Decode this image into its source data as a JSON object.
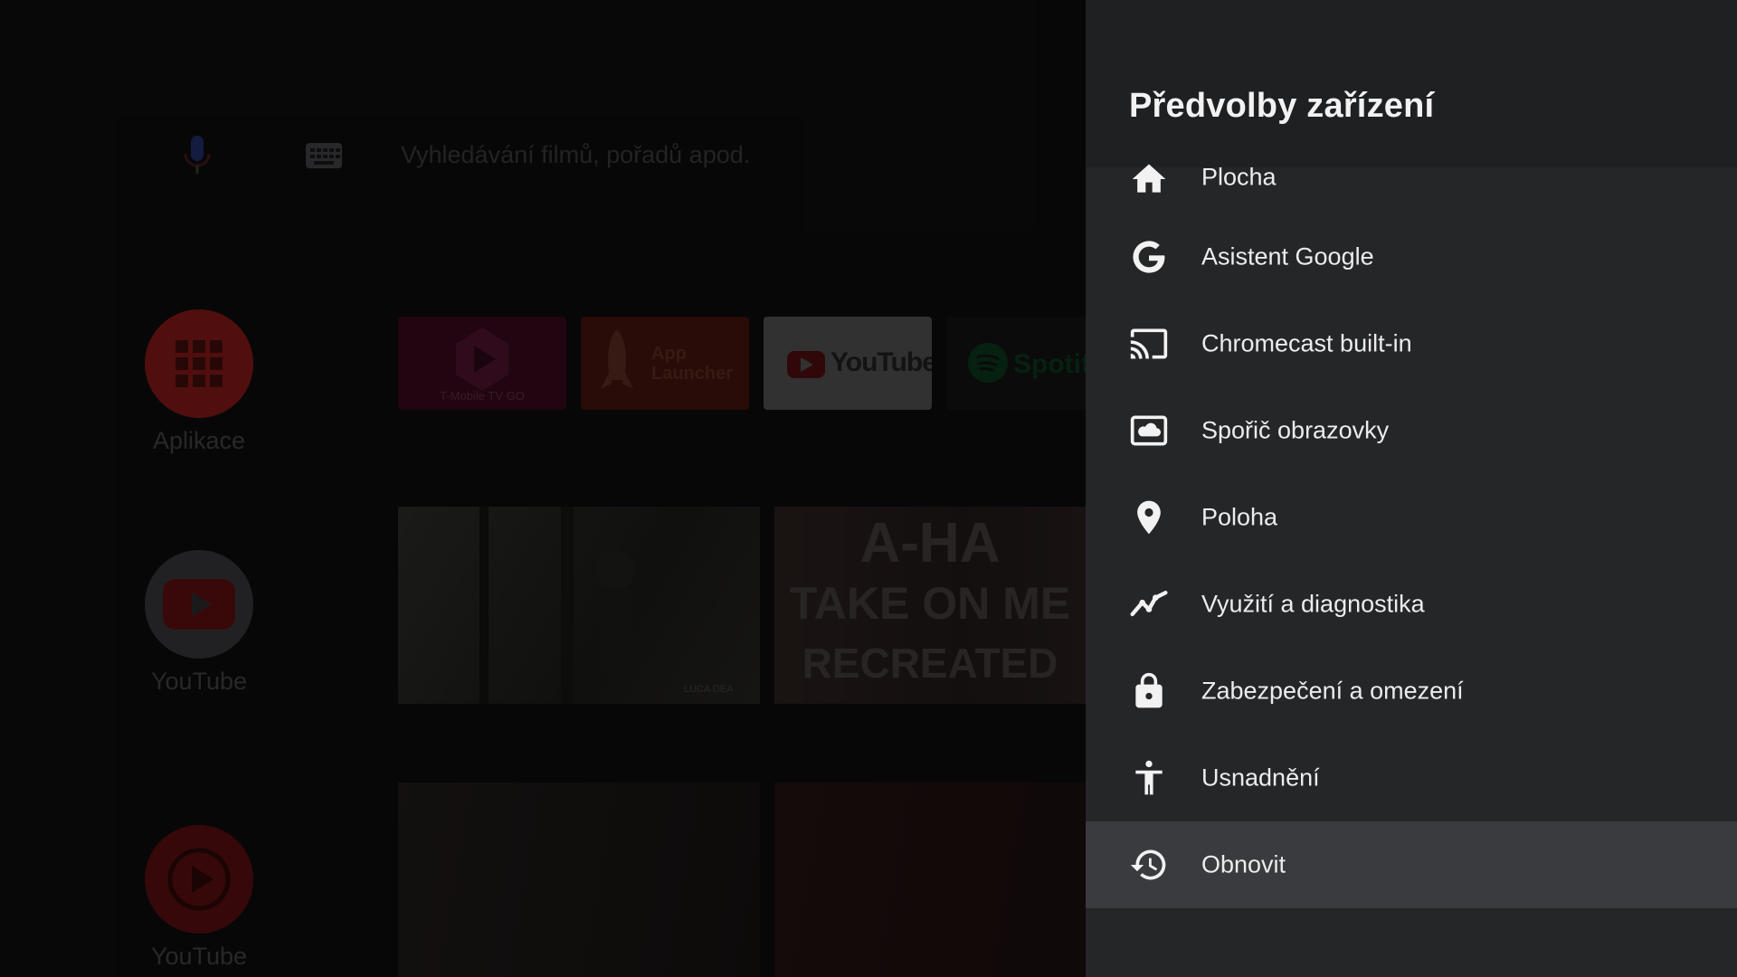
{
  "home": {
    "search_hint": "Vyhledávání filmů, pořadů apod.",
    "side_apps": [
      {
        "label": "Aplikace",
        "icon": "apps-grid-icon"
      },
      {
        "label": "YouTube",
        "icon": "youtube-icon"
      },
      {
        "label": "YouTube",
        "icon": "youtube-play-icon"
      }
    ],
    "tiles": [
      {
        "name": "T-Mobile TV GO",
        "caption": "T-Mobile TV GO"
      },
      {
        "name": "App Launcher",
        "line1": "App",
        "line2": "Launcher"
      },
      {
        "name": "YouTube",
        "text": "YouTube"
      },
      {
        "name": "Spotify",
        "text": "Spotif"
      }
    ],
    "banner": {
      "line1": "A-HA",
      "line2": "TAKE ON ME",
      "line3": "RECREATED",
      "credit": "LUCA DEA"
    },
    "colors": {
      "youtube_red": "#c4161c",
      "spotify_green": "#1db954",
      "launcher_orange": "#b8321c",
      "tmobile_pink": "#8a1344"
    }
  },
  "panel": {
    "title": "Předvolby zařízení",
    "items": [
      {
        "label": "Plocha",
        "icon": "home-icon"
      },
      {
        "label": "Asistent Google",
        "icon": "google-icon"
      },
      {
        "label": "Chromecast built-in",
        "icon": "cast-icon"
      },
      {
        "label": "Spořič obrazovky",
        "icon": "screensaver-icon"
      },
      {
        "label": "Poloha",
        "icon": "location-pin-icon"
      },
      {
        "label": "Využití a diagnostika",
        "icon": "usage-diagnostics-icon"
      },
      {
        "label": "Zabezpečení a omezení",
        "icon": "lock-icon"
      },
      {
        "label": "Usnadnění",
        "icon": "accessibility-icon"
      },
      {
        "label": "Obnovit",
        "icon": "reset-history-icon",
        "focused": true
      }
    ],
    "colors": {
      "background": "#252628",
      "header": "#1f2022",
      "focus": "#3a3b3e",
      "text": "#ececec"
    }
  }
}
